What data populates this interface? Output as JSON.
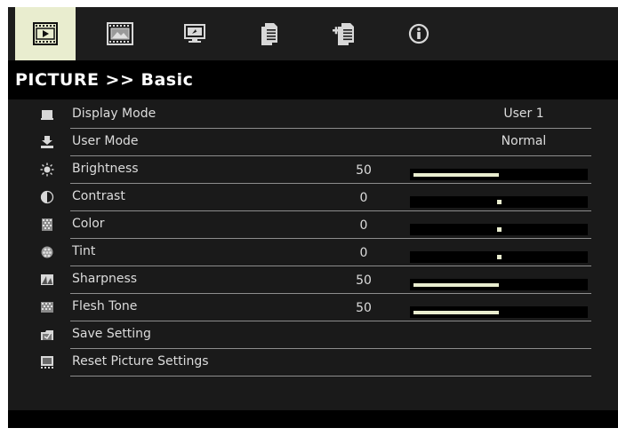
{
  "tabs": [
    {
      "icon": "picture-tab-icon"
    },
    {
      "icon": "display-tab-icon"
    },
    {
      "icon": "setup-tab-icon"
    },
    {
      "icon": "options-tab-icon"
    },
    {
      "icon": "advanced-options-tab-icon"
    },
    {
      "icon": "information-tab-icon"
    }
  ],
  "active_tab": 0,
  "title": "PICTURE >> Basic",
  "colors": {
    "background": "#1a1a1a",
    "highlight": "#e9edcf",
    "text": "#dcdcdc",
    "title_bar": "#000000"
  },
  "menu": {
    "items": [
      {
        "label": "Display Mode",
        "icon": "display-mode-icon",
        "setting": "User 1"
      },
      {
        "label": "User Mode",
        "icon": "user-mode-icon",
        "setting": "Normal"
      },
      {
        "label": "Brightness",
        "icon": "brightness-icon",
        "value": "50",
        "slider": {
          "min": -50,
          "max": 50,
          "value": 50
        }
      },
      {
        "label": "Contrast",
        "icon": "contrast-icon",
        "value": "0",
        "slider": {
          "min": -50,
          "max": 50,
          "value": 0
        }
      },
      {
        "label": "Color",
        "icon": "color-icon",
        "value": "0",
        "slider": {
          "min": -50,
          "max": 50,
          "value": 0
        }
      },
      {
        "label": "Tint",
        "icon": "tint-icon",
        "value": "0",
        "slider": {
          "min": -50,
          "max": 50,
          "value": 0
        }
      },
      {
        "label": "Sharpness",
        "icon": "sharpness-icon",
        "value": "50",
        "slider": {
          "min": -50,
          "max": 50,
          "value": 50
        }
      },
      {
        "label": "Flesh Tone",
        "icon": "flesh-tone-icon",
        "value": "50",
        "slider": {
          "min": -50,
          "max": 50,
          "value": 50
        }
      },
      {
        "label": "Save Setting",
        "icon": "save-setting-icon"
      },
      {
        "label": "Reset Picture Settings",
        "icon": "reset-picture-settings-icon"
      }
    ]
  }
}
